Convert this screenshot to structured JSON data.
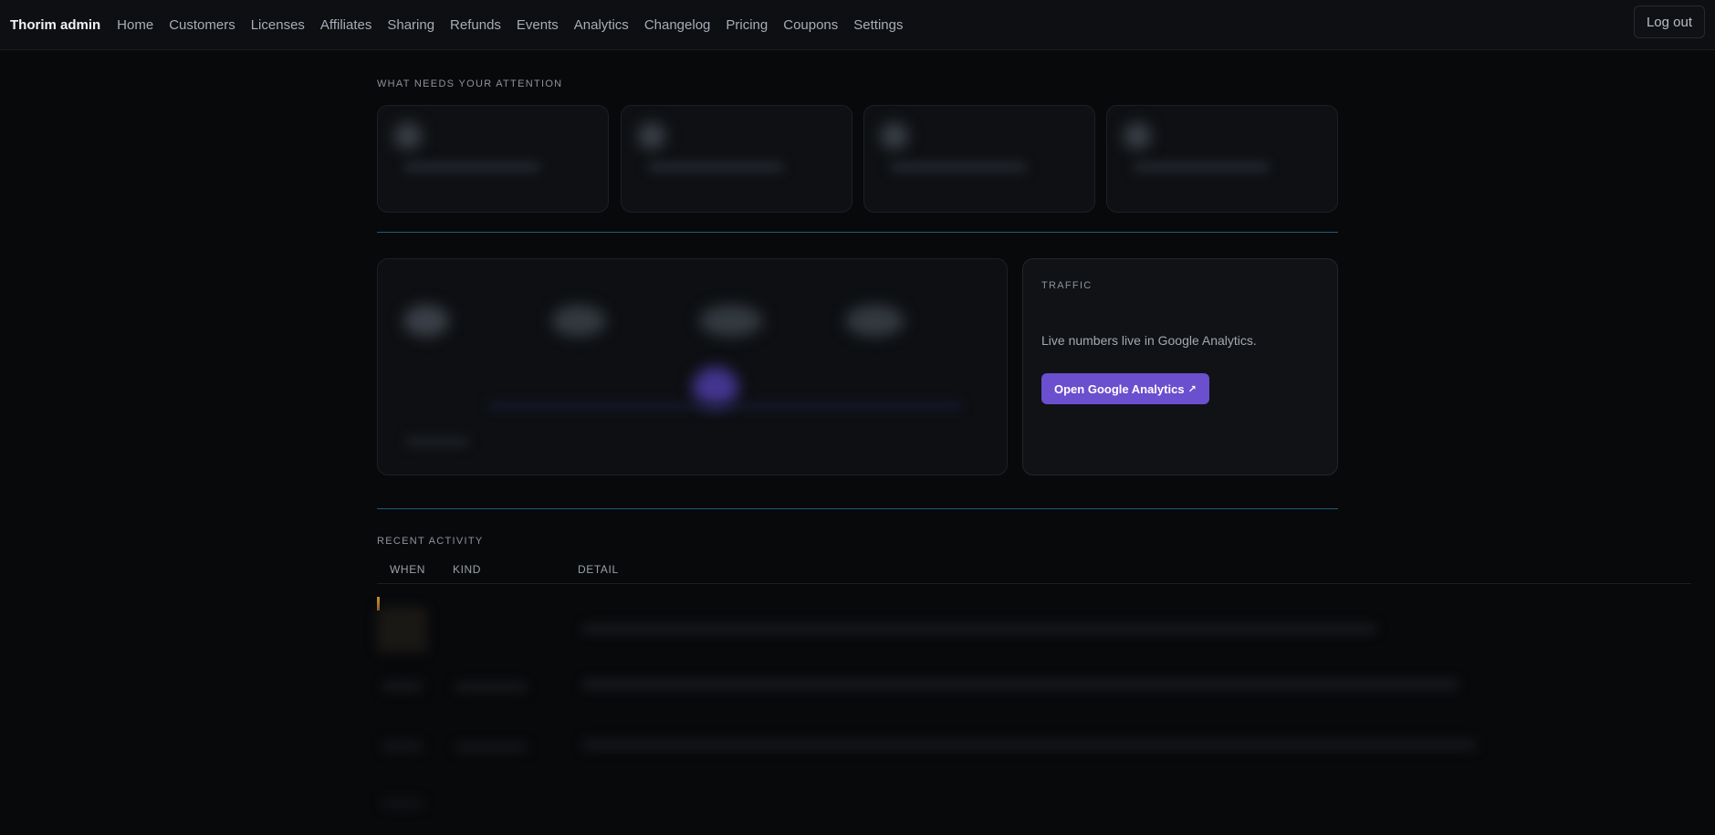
{
  "app": {
    "title": "Thorim admin"
  },
  "nav": {
    "items": [
      {
        "label": "Home"
      },
      {
        "label": "Customers"
      },
      {
        "label": "Licenses"
      },
      {
        "label": "Affiliates"
      },
      {
        "label": "Sharing"
      },
      {
        "label": "Refunds"
      },
      {
        "label": "Events"
      },
      {
        "label": "Analytics"
      },
      {
        "label": "Changelog"
      },
      {
        "label": "Pricing"
      },
      {
        "label": "Coupons"
      },
      {
        "label": "Settings"
      }
    ],
    "logout_label": "Log out"
  },
  "attention": {
    "title": "WHAT NEEDS YOUR ATTENTION"
  },
  "traffic": {
    "title": "TRAFFIC",
    "text": "Live numbers live in Google Analytics.",
    "button_label": "Open Google Analytics",
    "button_icon": "external-link-icon"
  },
  "recent": {
    "title": "RECENT ACTIVITY",
    "columns": [
      "WHEN",
      "KIND",
      "DETAIL"
    ]
  },
  "colors": {
    "accent": "#6a4fce",
    "divider": "#1f5c73",
    "marker": "#c98a2c"
  }
}
